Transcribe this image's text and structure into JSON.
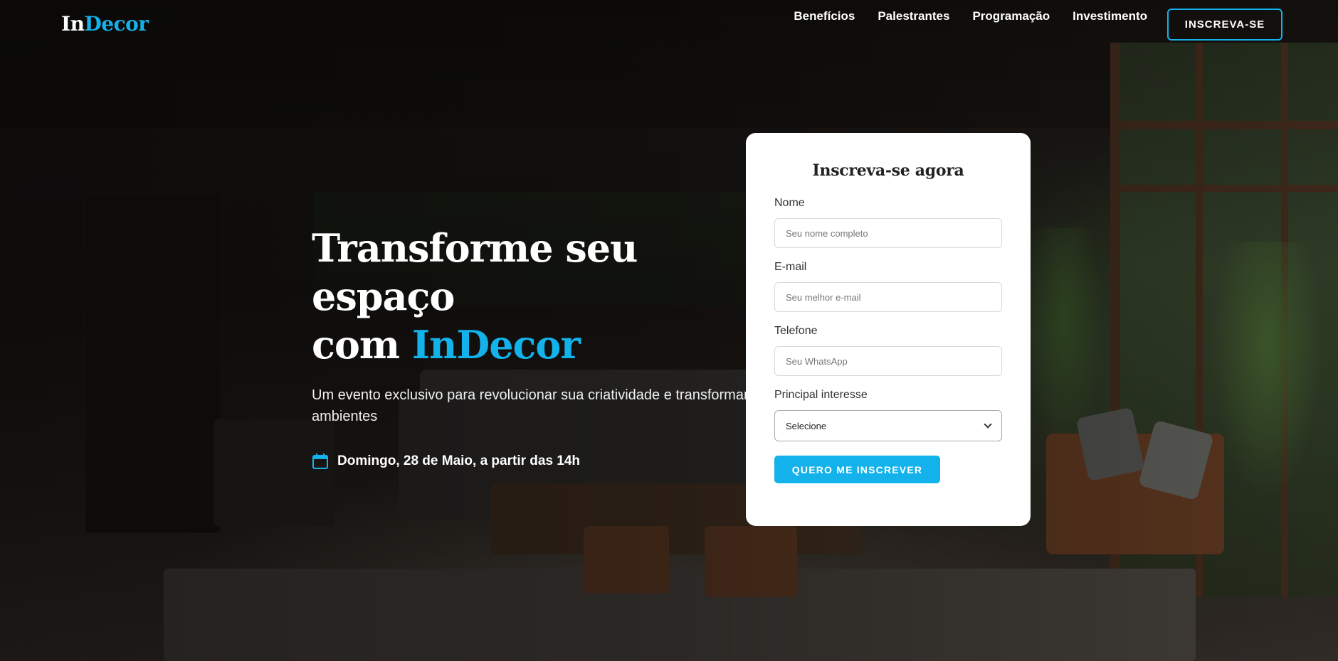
{
  "colors": {
    "accent": "#13b2ea",
    "card_bg": "#ffffff",
    "text_dark": "#222222"
  },
  "header": {
    "logo_part1": "In",
    "logo_part2": "Decor",
    "nav": [
      {
        "label": "Benefícios"
      },
      {
        "label": "Palestrantes"
      },
      {
        "label": "Programação"
      },
      {
        "label": "Investimento"
      }
    ],
    "cta_label": "INSCREVA-SE"
  },
  "hero": {
    "title_line1": "Transforme seu espaço",
    "title_line2_prefix": "com ",
    "title_line2_accent": "InDecor",
    "subtitle": "Um evento exclusivo para revolucionar sua criatividade e transformar ambientes",
    "date_icon": "calendar-icon",
    "date_text": "Domingo, 28 de Maio, a partir das 14h"
  },
  "form": {
    "title": "Inscreva-se agora",
    "name_label": "Nome",
    "name_placeholder": "Seu nome completo",
    "email_label": "E-mail",
    "email_placeholder": "Seu melhor e-mail",
    "phone_label": "Telefone",
    "phone_placeholder": "Seu WhatsApp",
    "interest_label": "Principal interesse",
    "interest_selected": "Selecione",
    "submit_label": "QUERO ME INSCREVER"
  }
}
